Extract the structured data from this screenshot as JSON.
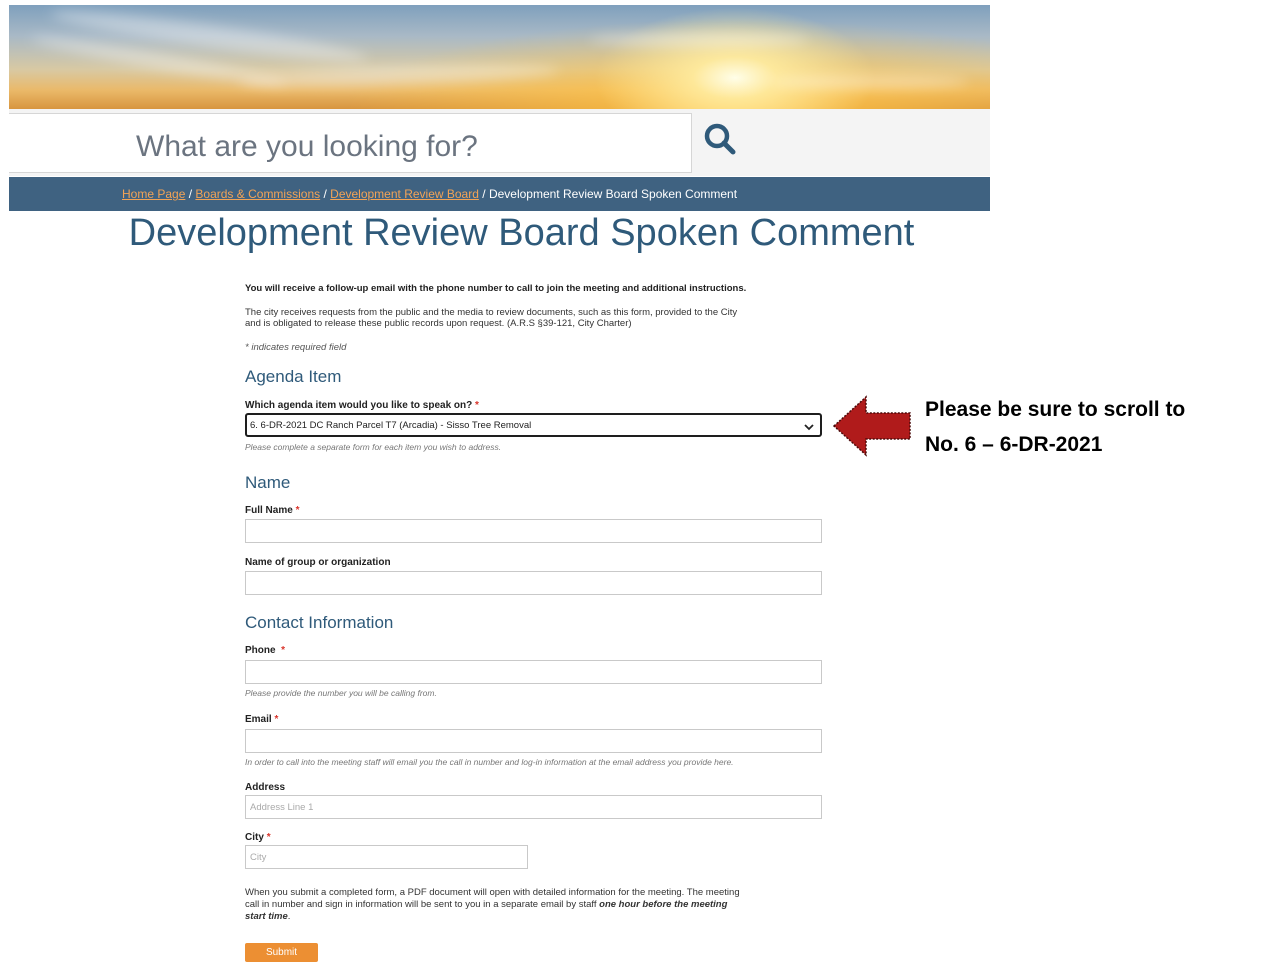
{
  "search": {
    "placeholder": "What are you looking for?"
  },
  "breadcrumb": {
    "home": "Home Page",
    "boards": "Boards & Commissions",
    "drb": "Development Review Board",
    "current": "Development Review Board Spoken Comment",
    "separator": "/"
  },
  "page": {
    "title": "Development Review Board Spoken Comment"
  },
  "intro": {
    "bold": "You will receive a follow-up email with the phone number to call to join the meeting and additional instructions.",
    "records_line1": "The city receives requests from the public and the media to review documents, such as this form, provided to the City",
    "records_line2": "and is obligated to release these public records upon request. (A.R.S §39-121, City Charter)",
    "required_note": "* indicates required field"
  },
  "agenda": {
    "section": "Agenda Item",
    "label": "Which agenda item would you like to speak on?",
    "selected": "6. 6-DR-2021 DC Ranch Parcel T7 (Arcadia) - Sisso Tree Removal",
    "hint": "Please complete a separate form for each item you wish to address."
  },
  "name_section": {
    "section": "Name",
    "full_name_label": "Full Name",
    "group_label": "Name of group or organization"
  },
  "contact": {
    "section": "Contact Information",
    "phone_label": "Phone",
    "phone_hint": "Please provide the number you will be calling from.",
    "email_label": "Email",
    "email_hint": "In order to call into the meeting staff will email you the call in number and log-in information at the email address you provide here.",
    "address_label": "Address",
    "address_placeholder": "Address Line 1",
    "city_label": "City",
    "city_placeholder": "City"
  },
  "footer_note": {
    "line1": "When you submit a completed form, a PDF document will open with detailed information for the meeting. The meeting",
    "line2_a": "call in number and sign in information will be sent to you in a separate email by staff ",
    "line2_b": "one hour before the meeting",
    "line3": "start time",
    "line3_end": "."
  },
  "submit_label": "Submit",
  "required_marker": "*",
  "callout": {
    "line1": "Please be sure to scroll to",
    "line2": "No. 6 – 6-DR-2021"
  },
  "colors": {
    "accent": "#2f5a7a",
    "breadcrumb_bar": "#3f6281",
    "link": "#f2a356",
    "submit": "#ec8f33",
    "arrow": "#b01b1b"
  },
  "icons": {
    "search": "magnifier-icon",
    "dropdown": "chevron-down-icon",
    "arrow": "left-arrow-icon"
  }
}
